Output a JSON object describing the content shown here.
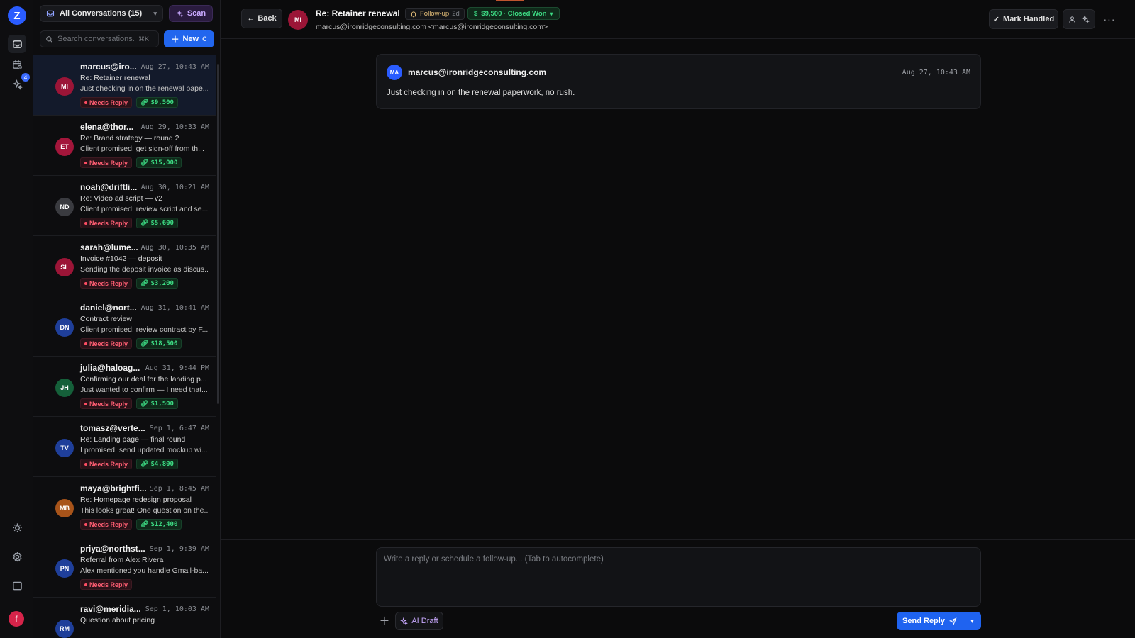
{
  "sidebar": {
    "logo": "Z",
    "notification_count": "4",
    "user_initial": "f"
  },
  "list": {
    "filter_label": "All Conversations (15)",
    "scan_label": "Scan",
    "search_placeholder": "Search conversations...",
    "search_shortcut": "⌘K",
    "new_label": "New",
    "new_shortcut": "C",
    "conversations": [
      {
        "initials": "MI",
        "color": "#9b1537",
        "sender": "marcus@iro...",
        "date": "Aug 27, 10:43 AM",
        "subject": "Re: Retainer renewal",
        "preview": "Just checking in on the renewal pape...",
        "status": "Needs Reply",
        "amount": "$9,500"
      },
      {
        "initials": "ET",
        "color": "#a3163b",
        "sender": "elena@thor...",
        "date": "Aug 29, 10:33 AM",
        "subject": "Re: Brand strategy — round 2",
        "preview": "Client promised: get sign-off from th...",
        "status": "Needs Reply",
        "amount": "$15,000"
      },
      {
        "initials": "ND",
        "color": "#3a3b40",
        "sender": "noah@driftli...",
        "date": "Aug 30, 10:21 AM",
        "subject": "Re: Video ad script — v2",
        "preview": "Client promised: review script and se...",
        "status": "Needs Reply",
        "amount": "$5,600"
      },
      {
        "initials": "SL",
        "color": "#9b1537",
        "sender": "sarah@lume...",
        "date": "Aug 30, 10:35 AM",
        "subject": "Invoice #1042 — deposit",
        "preview": "Sending the deposit invoice as discus...",
        "status": "Needs Reply",
        "amount": "$3,200"
      },
      {
        "initials": "DN",
        "color": "#1f3f9a",
        "sender": "daniel@nort...",
        "date": "Aug 31, 10:41 AM",
        "subject": "Contract review",
        "preview": "Client promised: review contract by F...",
        "status": "Needs Reply",
        "amount": "$18,500"
      },
      {
        "initials": "JH",
        "color": "#15603a",
        "sender": "julia@haloag...",
        "date": "Aug 31, 9:44 PM",
        "subject": "Confirming our deal for the landing p...",
        "preview": "Just wanted to confirm — I need that...",
        "status": "Needs Reply",
        "amount": "$1,500"
      },
      {
        "initials": "TV",
        "color": "#1f3f9a",
        "sender": "tomasz@verte...",
        "date": "Sep 1, 6:47 AM",
        "subject": "Re: Landing page — final round",
        "preview": "I promised: send updated mockup wi...",
        "status": "Needs Reply",
        "amount": "$4,800"
      },
      {
        "initials": "MB",
        "color": "#a8541a",
        "sender": "maya@brightfi...",
        "date": "Sep 1, 8:45 AM",
        "subject": "Re: Homepage redesign proposal",
        "preview": "This looks great! One question on the...",
        "status": "Needs Reply",
        "amount": "$12,400"
      },
      {
        "initials": "PN",
        "color": "#1f3f9a",
        "sender": "priya@northst...",
        "date": "Sep 1, 9:39 AM",
        "subject": "Referral from Alex Rivera",
        "preview": "Alex mentioned you handle Gmail-ba...",
        "status": "Needs Reply",
        "amount": ""
      },
      {
        "initials": "RM",
        "color": "#1f3f9a",
        "sender": "ravi@meridia...",
        "date": "Sep 1, 10:03 AM",
        "subject": "Question about pricing",
        "preview": "",
        "status": "",
        "amount": ""
      }
    ]
  },
  "header": {
    "back_label": "Back",
    "avatar_initials": "MI",
    "title": "Re: Retainer renewal",
    "followup_label": "Follow-up",
    "followup_age": "2d",
    "deal_label": "$9,500 · Closed Won",
    "email": "marcus@ironridgeconsulting.com <marcus@ironridgeconsulting.com>",
    "mark_handled_label": "Mark Handled"
  },
  "message": {
    "avatar_initials": "MA",
    "sender": "marcus@ironridgeconsulting.com",
    "date": "Aug 27, 10:43 AM",
    "body": "Just checking in on the renewal paperwork, no rush."
  },
  "composer": {
    "placeholder": "Write a reply or schedule a follow-up... (Tab to autocomplete)",
    "ai_draft_label": "AI Draft",
    "send_label": "Send Reply"
  }
}
